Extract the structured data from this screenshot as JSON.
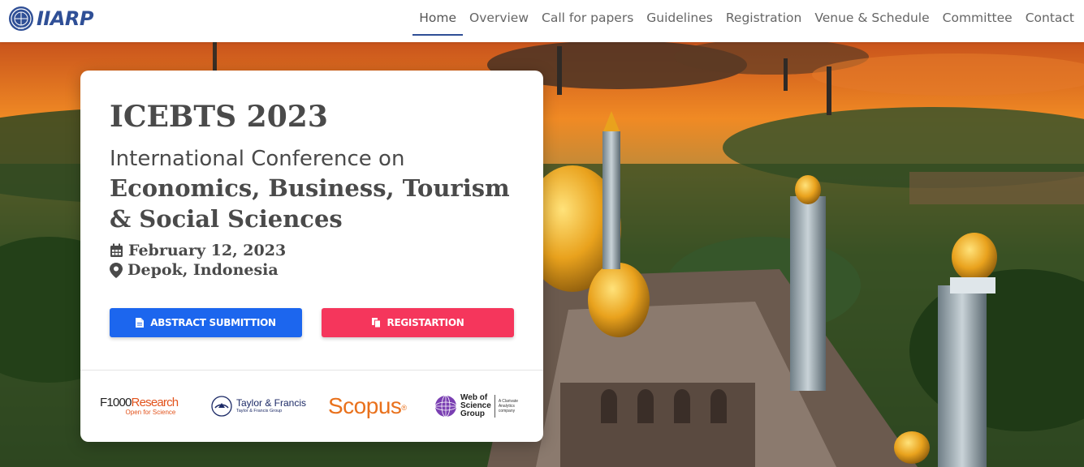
{
  "brand": {
    "name": "IIARP",
    "emblem_text": "IIARP"
  },
  "nav": {
    "items": [
      "Home",
      "Overview",
      "Call for papers",
      "Guidelines",
      "Registration",
      "Venue & Schedule",
      "Committee",
      "Contact"
    ],
    "active": "Home"
  },
  "hero": {
    "title": "ICEBTS 2023",
    "subtitle": "International Conference on",
    "topic": "Economics, Business, Tourism & Social Sciences",
    "date": "February 12, 2023",
    "location": "Depok, Indonesia",
    "buttons": {
      "abstract": "ABSTRACT SUBMITTION",
      "register": "REGISTARTION"
    }
  },
  "logos": {
    "f1000_main": "F1000",
    "f1000_accent": "Research",
    "f1000_sub": "Open for Science",
    "tf_main": "Taylor & Francis",
    "tf_sub": "Taylor & Francis Group",
    "scopus": "Scopus",
    "scopus_mark": "®",
    "wos_main_1": "Web of",
    "wos_main_2": "Science",
    "wos_main_3": "Group",
    "wos_small_1": "A Clarivate",
    "wos_small_2": "Analytics",
    "wos_small_3": "company"
  },
  "colors": {
    "brand": "#2f4f96",
    "primary_button": "#1c66ee",
    "danger_button": "#f5365c",
    "scopus": "#e9711c",
    "f1000_accent": "#e2531c"
  }
}
